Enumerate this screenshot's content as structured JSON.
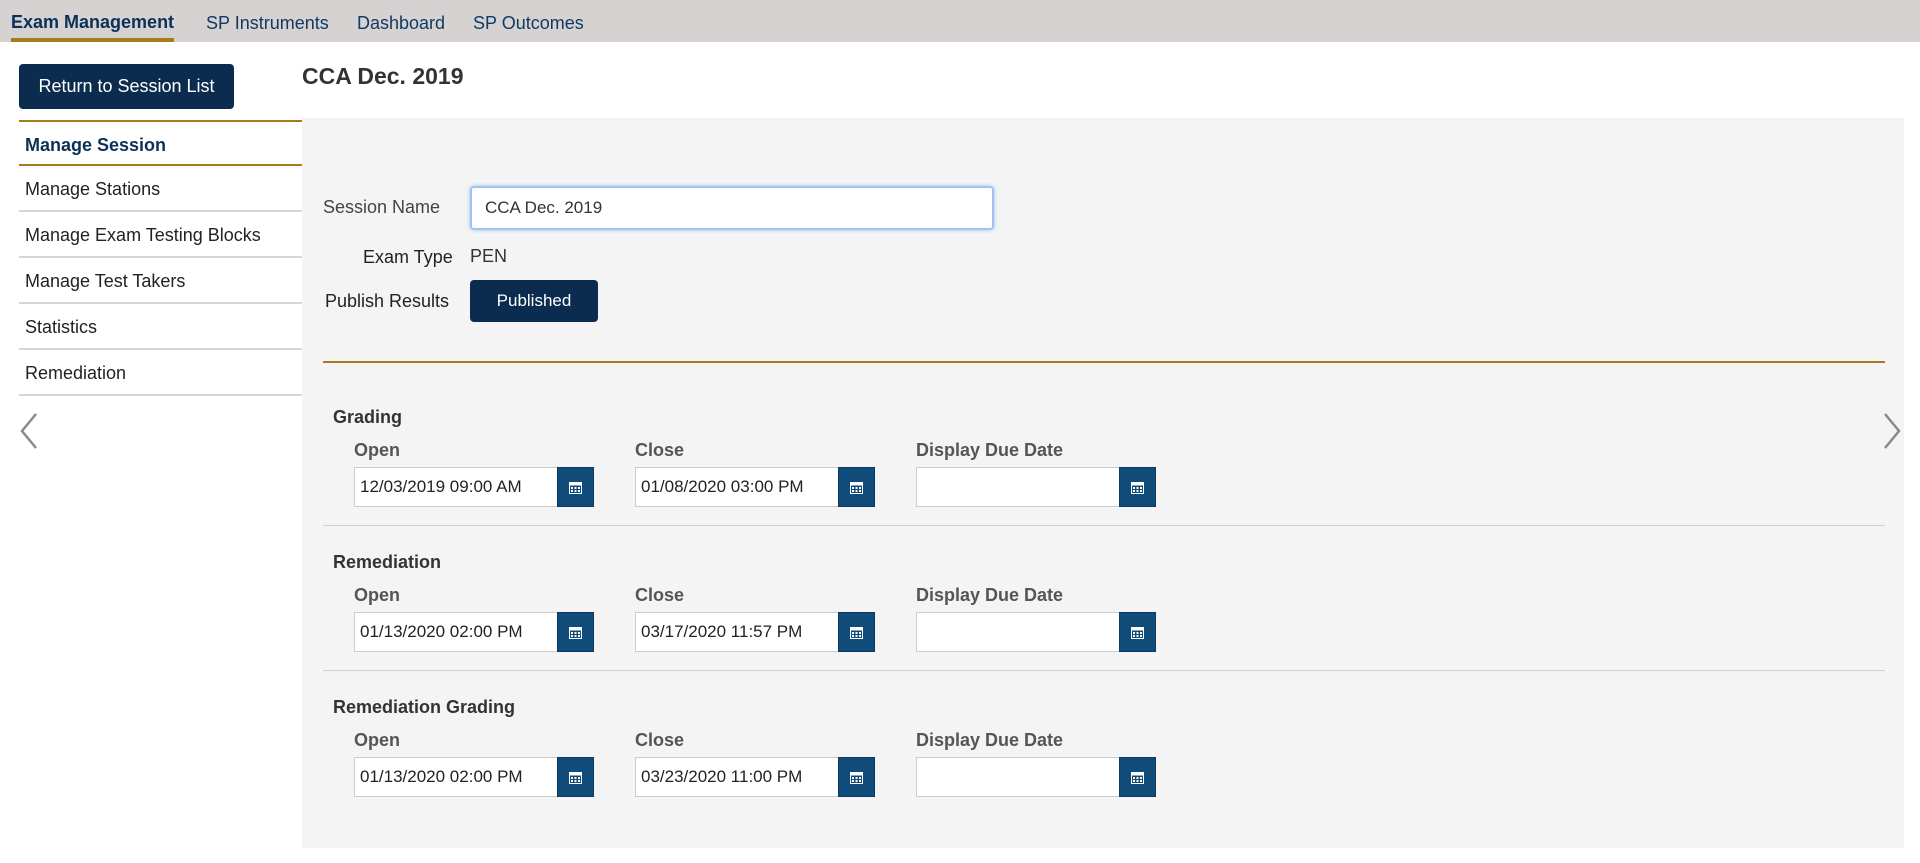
{
  "topnav": {
    "tabs": [
      {
        "label": "Exam Management",
        "active": true
      },
      {
        "label": "SP Instruments"
      },
      {
        "label": "Dashboard"
      },
      {
        "label": "SP Outcomes"
      }
    ]
  },
  "return_button": "Return to Session List",
  "page_title": "CCA Dec. 2019",
  "sidebar": {
    "items": [
      {
        "label": "Manage Session",
        "active": true
      },
      {
        "label": "Manage Stations"
      },
      {
        "label": "Manage Exam Testing Blocks"
      },
      {
        "label": "Manage Test Takers"
      },
      {
        "label": "Statistics"
      },
      {
        "label": "Remediation"
      }
    ]
  },
  "form": {
    "session_name_label": "Session Name",
    "session_name_value": "CCA Dec. 2019",
    "exam_type_label": "Exam Type",
    "exam_type_value": "PEN",
    "publish_results_label": "Publish Results",
    "publish_button": "Published"
  },
  "sections": [
    {
      "title": "Grading",
      "open_label": "Open",
      "open_value": "12/03/2019 09:00 AM",
      "close_label": "Close",
      "close_value": "01/08/2020 03:00 PM",
      "due_label": "Display Due Date",
      "due_value": ""
    },
    {
      "title": "Remediation",
      "open_label": "Open",
      "open_value": "01/13/2020 02:00 PM",
      "close_label": "Close",
      "close_value": "03/17/2020 11:57 PM",
      "due_label": "Display Due Date",
      "due_value": ""
    },
    {
      "title": "Remediation Grading",
      "open_label": "Open",
      "open_value": "01/13/2020 02:00 PM",
      "close_label": "Close",
      "close_value": "03/23/2020 11:00 PM",
      "due_label": "Display Due Date",
      "due_value": ""
    }
  ],
  "icons": {
    "calendar": "calendar-icon",
    "prev": "chevron-left-icon",
    "next": "chevron-right-icon"
  },
  "colors": {
    "primary": "#0b2c4f",
    "accent": "#a77a1b",
    "calendar_button": "#0f4c7a",
    "panel_bg": "#f4f4f4",
    "topnav_bg": "#d6d2d2"
  }
}
